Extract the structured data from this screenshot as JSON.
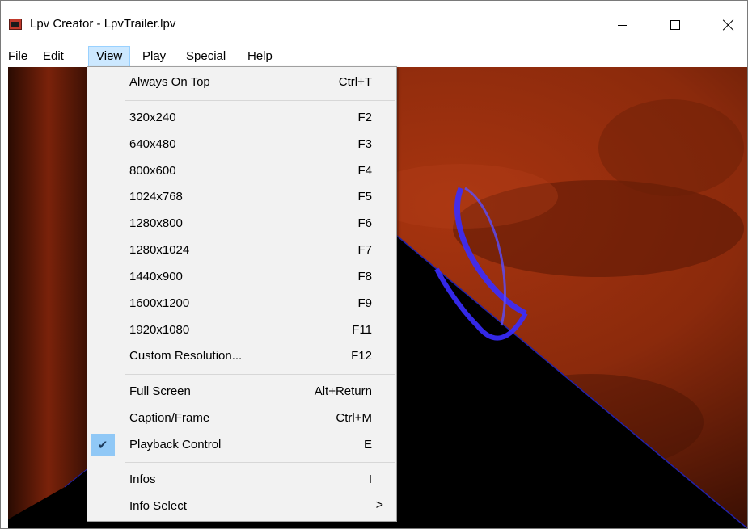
{
  "window": {
    "title": "Lpv Creator - LpvTrailer.lpv",
    "icon": "lpv-creator-app-icon"
  },
  "menubar": {
    "items": [
      {
        "label": "File"
      },
      {
        "label": "Edit"
      },
      {
        "label": "View",
        "active": true
      },
      {
        "label": "Play"
      },
      {
        "label": "Special"
      },
      {
        "label": "Help"
      }
    ]
  },
  "view_menu": {
    "items": [
      {
        "label": "Always On Top",
        "shortcut": "Ctrl+T"
      },
      {
        "label": "320x240",
        "shortcut": "F2"
      },
      {
        "label": "640x480",
        "shortcut": "F3"
      },
      {
        "label": "800x600",
        "shortcut": "F4"
      },
      {
        "label": "1024x768",
        "shortcut": "F5"
      },
      {
        "label": "1280x800",
        "shortcut": "F6"
      },
      {
        "label": "1280x1024",
        "shortcut": "F7"
      },
      {
        "label": "1440x900",
        "shortcut": "F8"
      },
      {
        "label": "1600x1200",
        "shortcut": "F9"
      },
      {
        "label": "1920x1080",
        "shortcut": "F11"
      },
      {
        "label": "Custom Resolution...",
        "shortcut": "F12"
      },
      {
        "label": "Full Screen",
        "shortcut": "Alt+Return"
      },
      {
        "label": "Caption/Frame",
        "shortcut": "Ctrl+M"
      },
      {
        "label": "Playback Control",
        "shortcut": "E",
        "checked": true
      },
      {
        "label": "Infos",
        "shortcut": "I"
      },
      {
        "label": "Info Select",
        "submenu_arrow": ">"
      }
    ]
  },
  "colors": {
    "menu_highlight": "#cce8ff",
    "check_highlight": "#90c8f6",
    "render_red": "#8b2a0c",
    "render_blue": "#3a2cff"
  }
}
